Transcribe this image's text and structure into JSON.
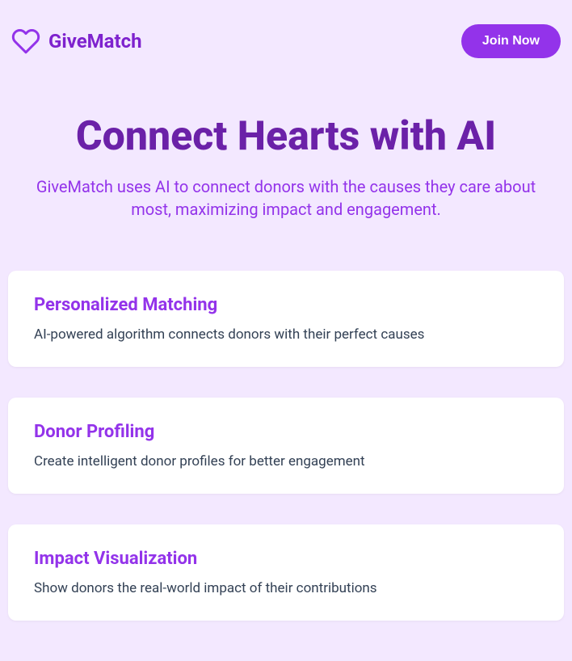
{
  "header": {
    "brand": "GiveMatch",
    "cta": "Join Now"
  },
  "hero": {
    "title": "Connect Hearts with AI",
    "subtitle": "GiveMatch uses AI to connect donors with the causes they care about most, maximizing impact and engagement."
  },
  "features": [
    {
      "title": "Personalized Matching",
      "description": "AI-powered algorithm connects donors with their perfect causes"
    },
    {
      "title": "Donor Profiling",
      "description": "Create intelligent donor profiles for better engagement"
    },
    {
      "title": "Impact Visualization",
      "description": "Show donors the real-world impact of their contributions"
    }
  ]
}
